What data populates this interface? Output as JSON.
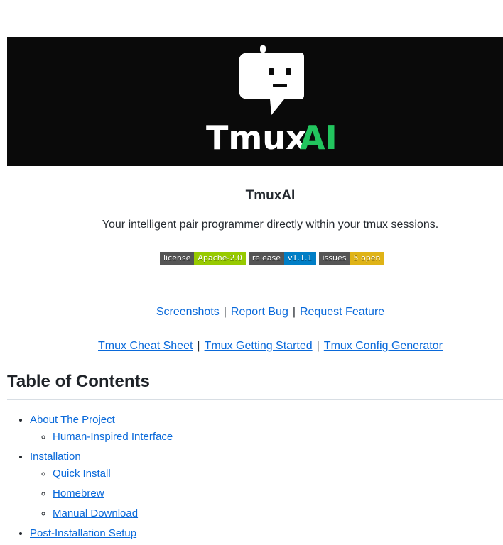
{
  "banner": {
    "logo_text_part1": "Tmux",
    "logo_text_part2": "AI",
    "accent_color": "#22c55e"
  },
  "title": "TmuxAI",
  "tagline": "Your intelligent pair programmer directly within your tmux sessions.",
  "badges": [
    {
      "key": "license",
      "value": "Apache-2.0",
      "color": "#97ca00"
    },
    {
      "key": "release",
      "value": "v1.1.1",
      "color": "#007ec6"
    },
    {
      "key": "issues",
      "value": "5 open",
      "color": "#dfb317"
    }
  ],
  "links_row1": [
    "Screenshots",
    "Report Bug",
    "Request Feature"
  ],
  "links_row2": [
    "Tmux Cheat Sheet",
    "Tmux Getting Started",
    "Tmux Config Generator"
  ],
  "separator": "|",
  "toc": {
    "heading": "Table of Contents",
    "items": [
      {
        "label": "About The Project",
        "children": [
          "Human-Inspired Interface"
        ]
      },
      {
        "label": "Installation",
        "children": [
          "Quick Install",
          "Homebrew",
          "Manual Download"
        ]
      },
      {
        "label": "Post-Installation Setup",
        "children": []
      }
    ]
  }
}
